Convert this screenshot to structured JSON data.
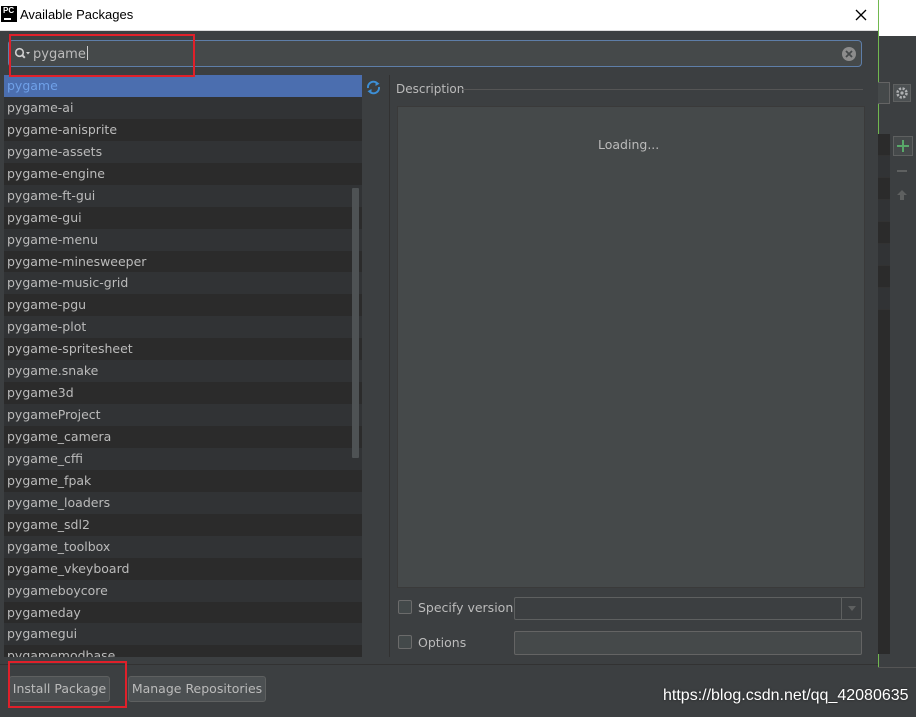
{
  "window": {
    "title": "Available Packages",
    "app_icon_text": "PC"
  },
  "search": {
    "value": "pygame"
  },
  "packages": [
    "pygame",
    "pygame-ai",
    "pygame-anisprite",
    "pygame-assets",
    "pygame-engine",
    "pygame-ft-gui",
    "pygame-gui",
    "pygame-menu",
    "pygame-minesweeper",
    "pygame-music-grid",
    "pygame-pgu",
    "pygame-plot",
    "pygame-spritesheet",
    "pygame.snake",
    "pygame3d",
    "pygameProject",
    "pygame_camera",
    "pygame_cffi",
    "pygame_fpak",
    "pygame_loaders",
    "pygame_sdl2",
    "pygame_toolbox",
    "pygame_vkeyboard",
    "pygameboycore",
    "pygameday",
    "pygamegui",
    "pygamemodbase"
  ],
  "selected_index": 0,
  "description": {
    "label": "Description",
    "loading_text": "Loading..."
  },
  "options": {
    "specify_version_label": "Specify version",
    "specify_version_checked": false,
    "version_value": "",
    "options_label": "Options",
    "options_checked": false,
    "options_value": ""
  },
  "buttons": {
    "install": "Install Package",
    "manage": "Manage Repositories"
  },
  "watermark": "https://blog.csdn.net/qq_42080635",
  "colors": {
    "background": "#3c3f41",
    "list_bg": "#2b2b2b",
    "selection": "#4b6eaf",
    "accent_focus": "#5e7ea8",
    "annotation_red": "#e0202a",
    "add_green": "#59a869"
  },
  "icons": {
    "app": "pycharm-icon",
    "close": "close-icon",
    "search": "search-icon",
    "clear": "clear-icon",
    "refresh": "refresh-icon",
    "dropdown": "chevron-down-icon",
    "settings": "gear-icon",
    "add": "plus-icon",
    "remove": "minus-icon",
    "upgrade": "arrow-up-icon"
  }
}
